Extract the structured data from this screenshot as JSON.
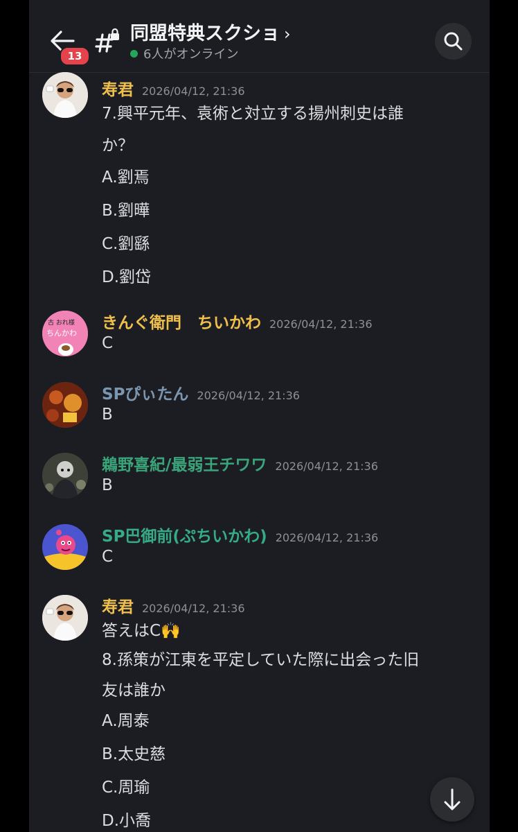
{
  "header": {
    "badge": "13",
    "title": "同盟特典スクショ",
    "chevron": "›",
    "online": "6人がオンライン",
    "icons": [
      "back-arrow-icon",
      "hashtag-lock-icon",
      "search-icon"
    ],
    "online_color": "#23a55a",
    "badge_color": "#e5434b"
  },
  "messages": [
    {
      "name": "寿君",
      "time": "2026/04/12, 21:36",
      "lines": [
        "7.興平元年、袁術と対立する揚州刺史は誰",
        "か？",
        "A.劉焉",
        "B.劉曄",
        "C.劉繇",
        "D.劉岱"
      ]
    },
    {
      "name": "きんぐ衛門　ちいかわ",
      "time": "2026/04/12, 21:36",
      "lines": [
        "C"
      ]
    },
    {
      "name": "SPぴぃたん",
      "time": "2026/04/12, 21:36",
      "lines": [
        "B"
      ]
    },
    {
      "name": "鵜野喜紀/最弱王チワワ",
      "time": "2026/04/12, 21:36",
      "lines": [
        "B"
      ]
    },
    {
      "name": "SP巴御前(ぷちいかわ)",
      "time": "2026/04/12, 21:36",
      "lines": [
        "C"
      ]
    },
    {
      "name": "寿君",
      "time": "2026/04/12, 21:36",
      "lines": [
        "答えはC🙌",
        "8.孫策が江東を平定していた際に出会った旧",
        "友は誰か",
        "A.周泰",
        "B.太史慈",
        "C.周瑜",
        "D.小喬"
      ]
    }
  ],
  "avatar_text": {
    "chiikawa_top": "古 おれ様",
    "chiikawa_bottom": "ちんかわ"
  },
  "fab_icon": "arrow-down-icon"
}
